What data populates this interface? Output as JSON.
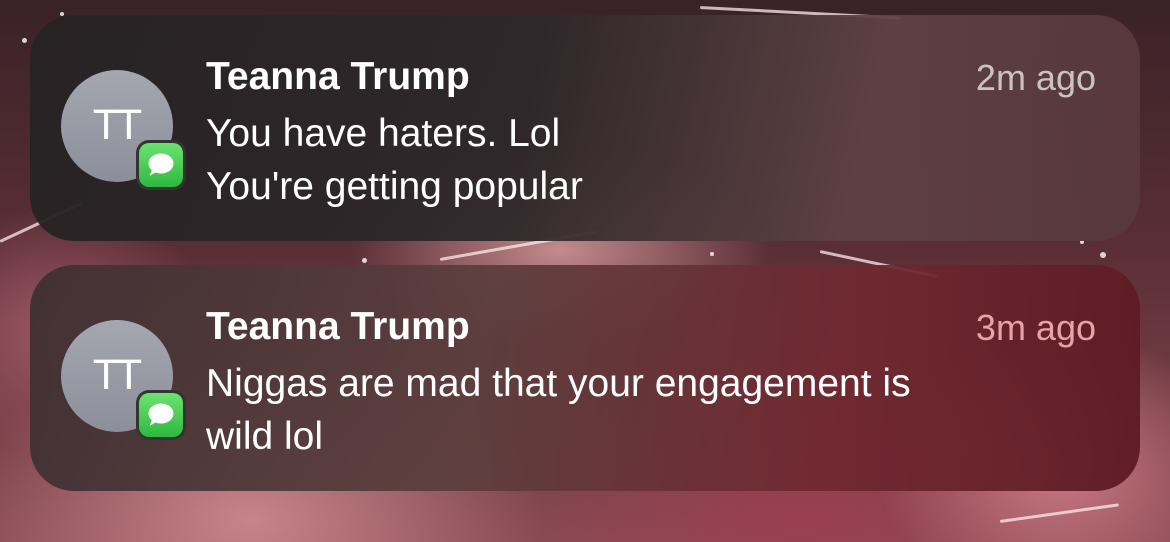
{
  "notifications": [
    {
      "avatar_initials": "TT",
      "app_icon": "messages-icon",
      "sender": "Teanna Trump",
      "time": "2m ago",
      "message_lines": [
        "You have haters. Lol",
        "You're getting popular"
      ]
    },
    {
      "avatar_initials": "TT",
      "app_icon": "messages-icon",
      "sender": "Teanna Trump",
      "time": "3m ago",
      "message_lines": [
        "Niggas are mad that your engagement is",
        "wild lol"
      ]
    }
  ],
  "colors": {
    "messages_green": "#34c759",
    "avatar_gray": "#9a9da6",
    "time_gray": "#c9c4c4",
    "time_pink": "#e8a3a6"
  }
}
